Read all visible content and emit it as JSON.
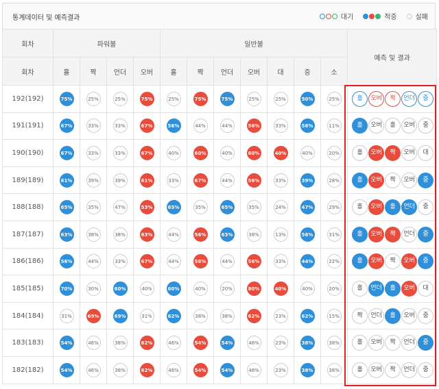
{
  "title": "통계데이터 및 예측결과",
  "legend": {
    "wait": "대기",
    "hit": "적중",
    "miss": "실패",
    "colors": {
      "blue": "#2f8fd8",
      "red": "#e84c3d",
      "green": "#3cb371",
      "gray": "#cccccc"
    }
  },
  "header": {
    "round": "회차",
    "power": "파워볼",
    "normal": "일반볼",
    "prediction": "예측 및 결과",
    "cols": [
      "홀",
      "짝",
      "언더",
      "오버",
      "홀",
      "짝",
      "언더",
      "오버",
      "대",
      "중",
      "소"
    ]
  },
  "rows": [
    {
      "round": "192(192)",
      "cells": [
        [
          "75%",
          "b"
        ],
        [
          "25%",
          "w"
        ],
        [
          "25%",
          "w"
        ],
        [
          "75%",
          "r"
        ],
        [
          "25%",
          "w"
        ],
        [
          "75%",
          "r"
        ],
        [
          "75%",
          "b"
        ],
        [
          "25%",
          "w"
        ],
        [
          "25%",
          "w"
        ],
        [
          "50%",
          "b"
        ],
        [
          "25%",
          "w"
        ]
      ],
      "result": [
        [
          "홀",
          "ob"
        ],
        [
          "오버",
          "or"
        ],
        [
          "짝",
          "or"
        ],
        [
          "언더",
          "ob"
        ],
        [
          "중",
          "ob"
        ]
      ]
    },
    {
      "round": "191(191)",
      "cells": [
        [
          "67%",
          "b"
        ],
        [
          "33%",
          "w"
        ],
        [
          "33%",
          "w"
        ],
        [
          "67%",
          "r"
        ],
        [
          "56%",
          "b"
        ],
        [
          "44%",
          "w"
        ],
        [
          "44%",
          "w"
        ],
        [
          "56%",
          "r"
        ],
        [
          "33%",
          "w"
        ],
        [
          "56%",
          "b"
        ],
        [
          "11%",
          "w"
        ]
      ],
      "result": [
        [
          "홀",
          "b"
        ],
        [
          "오버",
          "w"
        ],
        [
          "홀",
          "w"
        ],
        [
          "오버",
          "w"
        ],
        [
          "중",
          "w"
        ]
      ]
    },
    {
      "round": "190(190)",
      "cells": [
        [
          "67%",
          "b"
        ],
        [
          "33%",
          "w"
        ],
        [
          "33%",
          "w"
        ],
        [
          "67%",
          "r"
        ],
        [
          "40%",
          "w"
        ],
        [
          "60%",
          "r"
        ],
        [
          "40%",
          "w"
        ],
        [
          "60%",
          "r"
        ],
        [
          "40%",
          "r"
        ],
        [
          "40%",
          "w"
        ],
        [
          "20%",
          "w"
        ]
      ],
      "result": [
        [
          "홀",
          "w"
        ],
        [
          "오버",
          "r"
        ],
        [
          "짝",
          "r"
        ],
        [
          "오버",
          "w"
        ],
        [
          "대",
          "w"
        ]
      ]
    },
    {
      "round": "189(189)",
      "cells": [
        [
          "61%",
          "b"
        ],
        [
          "39%",
          "w"
        ],
        [
          "39%",
          "w"
        ],
        [
          "61%",
          "r"
        ],
        [
          "33%",
          "w"
        ],
        [
          "67%",
          "r"
        ],
        [
          "44%",
          "w"
        ],
        [
          "56%",
          "r"
        ],
        [
          "33%",
          "w"
        ],
        [
          "39%",
          "b"
        ],
        [
          "28%",
          "w"
        ]
      ],
      "result": [
        [
          "홀",
          "b"
        ],
        [
          "오버",
          "r"
        ],
        [
          "짝",
          "w"
        ],
        [
          "오버",
          "w"
        ],
        [
          "중",
          "b"
        ]
      ]
    },
    {
      "round": "188(188)",
      "cells": [
        [
          "65%",
          "b"
        ],
        [
          "35%",
          "w"
        ],
        [
          "47%",
          "w"
        ],
        [
          "53%",
          "r"
        ],
        [
          "65%",
          "b"
        ],
        [
          "35%",
          "w"
        ],
        [
          "65%",
          "b"
        ],
        [
          "35%",
          "w"
        ],
        [
          "24%",
          "w"
        ],
        [
          "47%",
          "b"
        ],
        [
          "29%",
          "w"
        ]
      ],
      "result": [
        [
          "홀",
          "w"
        ],
        [
          "오버",
          "r"
        ],
        [
          "홀",
          "b"
        ],
        [
          "언더",
          "b"
        ],
        [
          "중",
          "w"
        ]
      ]
    },
    {
      "round": "187(187)",
      "cells": [
        [
          "63%",
          "b"
        ],
        [
          "38%",
          "w"
        ],
        [
          "38%",
          "w"
        ],
        [
          "63%",
          "r"
        ],
        [
          "44%",
          "w"
        ],
        [
          "56%",
          "r"
        ],
        [
          "63%",
          "b"
        ],
        [
          "38%",
          "w"
        ],
        [
          "13%",
          "w"
        ],
        [
          "56%",
          "b"
        ],
        [
          "31%",
          "w"
        ]
      ],
      "result": [
        [
          "홀",
          "b"
        ],
        [
          "오버",
          "r"
        ],
        [
          "짝",
          "r"
        ],
        [
          "언더",
          "w"
        ],
        [
          "중",
          "b"
        ]
      ]
    },
    {
      "round": "186(186)",
      "cells": [
        [
          "56%",
          "b"
        ],
        [
          "44%",
          "w"
        ],
        [
          "33%",
          "w"
        ],
        [
          "67%",
          "r"
        ],
        [
          "44%",
          "w"
        ],
        [
          "56%",
          "r"
        ],
        [
          "44%",
          "w"
        ],
        [
          "56%",
          "r"
        ],
        [
          "33%",
          "w"
        ],
        [
          "44%",
          "b"
        ],
        [
          "22%",
          "w"
        ]
      ],
      "result": [
        [
          "홀",
          "b"
        ],
        [
          "오버",
          "r"
        ],
        [
          "짝",
          "w"
        ],
        [
          "오버",
          "r"
        ],
        [
          "중",
          "b"
        ]
      ]
    },
    {
      "round": "185(185)",
      "cells": [
        [
          "70%",
          "b"
        ],
        [
          "30%",
          "w"
        ],
        [
          "60%",
          "b"
        ],
        [
          "40%",
          "w"
        ],
        [
          "60%",
          "b"
        ],
        [
          "40%",
          "w"
        ],
        [
          "20%",
          "w"
        ],
        [
          "80%",
          "r"
        ],
        [
          "40%",
          "r"
        ],
        [
          "40%",
          "w"
        ],
        [
          "20%",
          "w"
        ]
      ],
      "result": [
        [
          "홀",
          "w"
        ],
        [
          "언더",
          "b"
        ],
        [
          "홀",
          "b"
        ],
        [
          "오버",
          "r"
        ],
        [
          "대",
          "w"
        ]
      ]
    },
    {
      "round": "184(184)",
      "cells": [
        [
          "31%",
          "w"
        ],
        [
          "69%",
          "r"
        ],
        [
          "69%",
          "b"
        ],
        [
          "31%",
          "w"
        ],
        [
          "62%",
          "b"
        ],
        [
          "38%",
          "w"
        ],
        [
          "38%",
          "w"
        ],
        [
          "62%",
          "r"
        ],
        [
          "23%",
          "w"
        ],
        [
          "62%",
          "b"
        ],
        [
          "15%",
          "w"
        ]
      ],
      "result": [
        [
          "짝",
          "w"
        ],
        [
          "언더",
          "w"
        ],
        [
          "홀",
          "b"
        ],
        [
          "오버",
          "w"
        ],
        [
          "중",
          "w"
        ]
      ]
    },
    {
      "round": "183(183)",
      "cells": [
        [
          "54%",
          "b"
        ],
        [
          "46%",
          "w"
        ],
        [
          "38%",
          "w"
        ],
        [
          "62%",
          "r"
        ],
        [
          "46%",
          "w"
        ],
        [
          "54%",
          "r"
        ],
        [
          "54%",
          "b"
        ],
        [
          "46%",
          "w"
        ],
        [
          "23%",
          "w"
        ],
        [
          "38%",
          "b"
        ],
        [
          "38%",
          "w"
        ]
      ],
      "result": [
        [
          "홀",
          "w"
        ],
        [
          "오버",
          "w"
        ],
        [
          "짝",
          "w"
        ],
        [
          "언더",
          "w"
        ],
        [
          "중",
          "b"
        ]
      ]
    },
    {
      "round": "182(182)",
      "cells": [
        [
          "54%",
          "b"
        ],
        [
          "46%",
          "w"
        ],
        [
          "38%",
          "w"
        ],
        [
          "62%",
          "r"
        ],
        [
          "46%",
          "w"
        ],
        [
          "54%",
          "r"
        ],
        [
          "54%",
          "b"
        ],
        [
          "46%",
          "w"
        ],
        [
          "23%",
          "w"
        ],
        [
          "38%",
          "b"
        ],
        [
          "38%",
          "w"
        ]
      ],
      "result": [
        [
          "홀",
          "w"
        ],
        [
          "오버",
          "w"
        ],
        [
          "짝",
          "w"
        ],
        [
          "언더",
          "w"
        ],
        [
          "중",
          "w"
        ]
      ]
    }
  ]
}
